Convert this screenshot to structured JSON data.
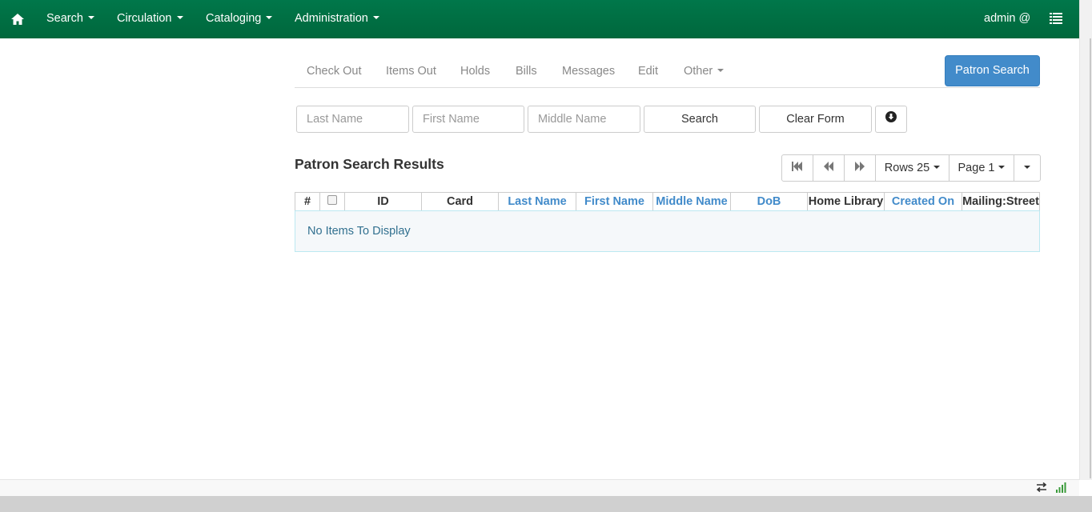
{
  "navbar": {
    "menus": [
      "Search",
      "Circulation",
      "Cataloging",
      "Administration"
    ],
    "user_label": "admin @",
    "background": "#00703f"
  },
  "tabs": [
    "Check Out",
    "Items Out",
    "Holds",
    "Bills",
    "Messages",
    "Edit",
    "Other"
  ],
  "patron_search_button": "Patron Search",
  "search_form": {
    "last_name_placeholder": "Last Name",
    "first_name_placeholder": "First Name",
    "middle_name_placeholder": "Middle Name",
    "search_label": "Search",
    "clear_label": "Clear Form",
    "expand_icon": "circle-arrow-down-icon"
  },
  "results": {
    "title": "Patron Search Results",
    "rows_label": "Rows 25",
    "page_label": "Page 1",
    "columns": [
      "#",
      "",
      "ID",
      "Card",
      "Last Name",
      "First Name",
      "Middle Name",
      "DoB",
      "Home Library",
      "Created On",
      "Mailing:Street"
    ],
    "empty_message": "No Items To Display"
  },
  "colors": {
    "accent": "#428bca",
    "nav_green": "#00703f"
  }
}
